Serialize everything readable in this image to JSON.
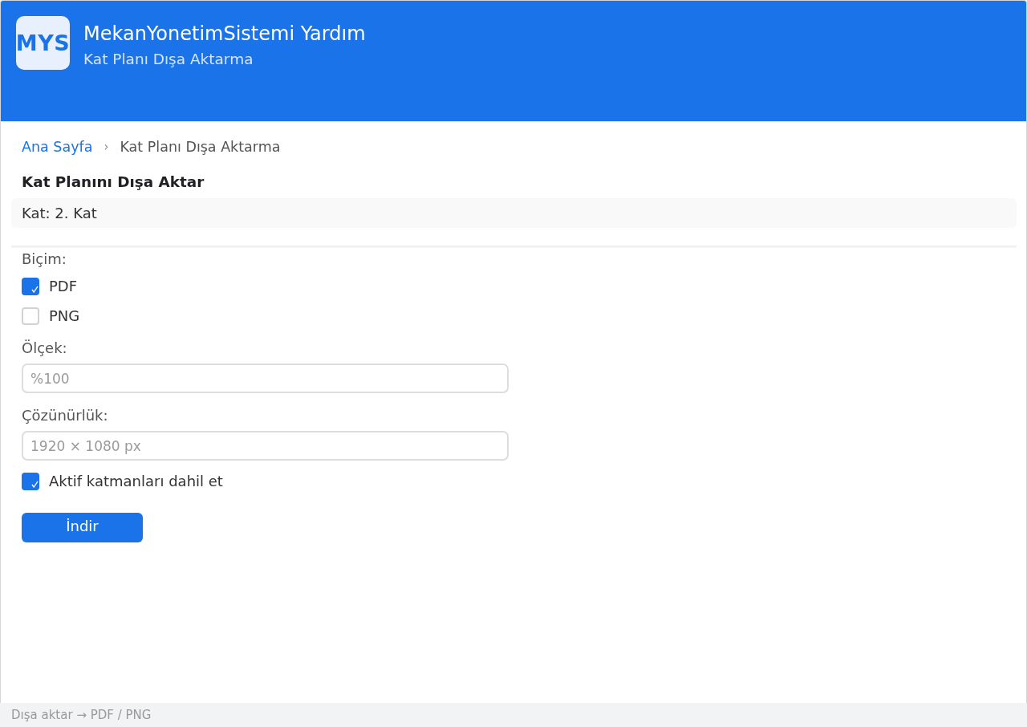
{
  "header": {
    "logo": "MYS",
    "title": "MekanYonetimSistemi Yardım",
    "subtitle": "Kat Planı Dışa Aktarma"
  },
  "breadcrumb": {
    "items": [
      {
        "label": "Ana Sayfa",
        "kind": "link"
      },
      {
        "label": "Kat Planı Dışa Aktarma",
        "kind": "current"
      }
    ],
    "separator": "›"
  },
  "heading": "Kat Planını Dışa Aktar",
  "info": "Kat: 2. Kat",
  "form": {
    "format_label": "Biçim:",
    "formats": [
      {
        "label": "PDF",
        "checked": true
      },
      {
        "label": "PNG",
        "checked": false
      }
    ],
    "fields": [
      {
        "label": "Ölçek:",
        "placeholder": "%100"
      },
      {
        "label": "Çözünürlük:",
        "placeholder": "1920 × 1080 px"
      }
    ],
    "layers": {
      "label": "Aktif katmanları dahil et",
      "checked": true
    },
    "submit": "İndir"
  },
  "status_bar": "Dışa aktar → PDF / PNG"
}
